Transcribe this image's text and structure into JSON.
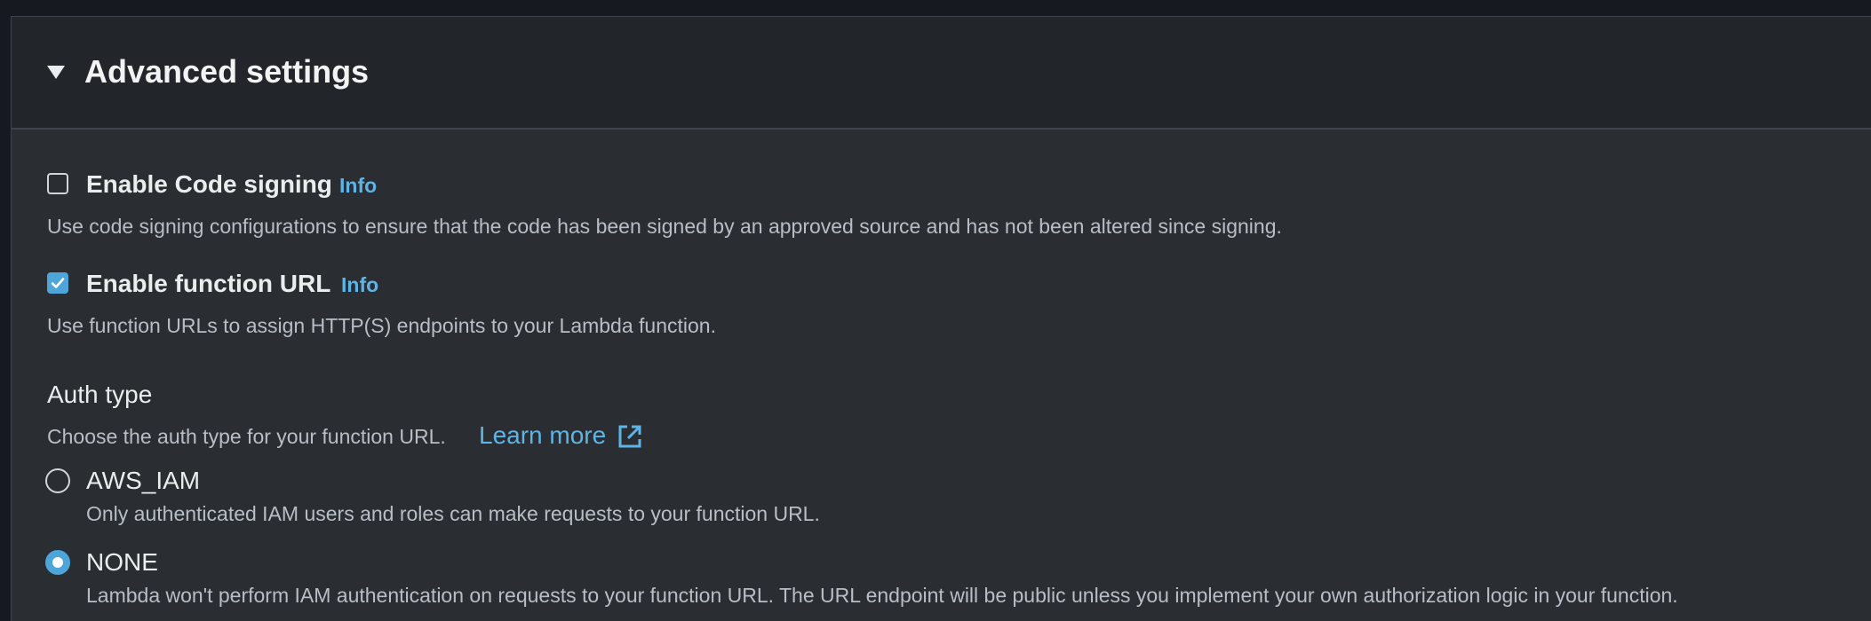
{
  "section": {
    "title": "Advanced settings",
    "expanded": true
  },
  "code_signing": {
    "label": "Enable Code signing",
    "info": "Info",
    "checked": false,
    "description": "Use code signing configurations to ensure that the code has been signed by an approved source and has not been altered since signing."
  },
  "function_url": {
    "label": "Enable function URL",
    "info": "Info",
    "checked": true,
    "description": "Use function URLs to assign HTTP(S) endpoints to your Lambda function."
  },
  "auth_type": {
    "label": "Auth type",
    "description": "Choose the auth type for your function URL.",
    "learn_more": "Learn more",
    "selected": "NONE",
    "options": [
      {
        "label": "AWS_IAM",
        "description": "Only authenticated IAM users and roles can make requests to your function URL."
      },
      {
        "label": "NONE",
        "description": "Lambda won't perform IAM authentication on requests to your function URL. The URL endpoint will be public unless you implement your own authorization logic in your function."
      }
    ]
  },
  "colors": {
    "accent": "#4ea5d9",
    "link": "#5fb4e6",
    "panel_bg": "#2a2e33",
    "header_bg": "#22262b"
  },
  "icons": {
    "caret": "caret-down-icon",
    "external_link": "external-link-icon",
    "check": "checkmark-icon"
  }
}
